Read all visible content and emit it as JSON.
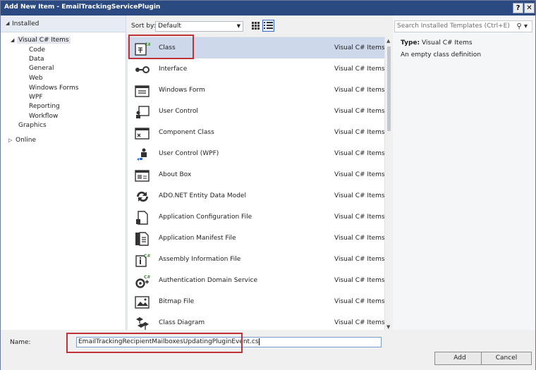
{
  "window": {
    "title": "Add New Item - EmailTrackingServicePlugin",
    "help_label": "?",
    "close_label": "✕"
  },
  "left": {
    "installed_label": "Installed",
    "root_label": "Visual C# Items",
    "children": [
      "Code",
      "Data",
      "General",
      "Web",
      "Windows Forms",
      "WPF",
      "Reporting",
      "Workflow"
    ],
    "graphics_label": "Graphics",
    "online_label": "Online"
  },
  "toolbar": {
    "sort_label": "Sort by:",
    "sort_value": "Default"
  },
  "search": {
    "placeholder": "Search Installed Templates (Ctrl+E)"
  },
  "items": [
    {
      "name": "Class",
      "category": "Visual C# Items",
      "icon": "class-icon"
    },
    {
      "name": "Interface",
      "category": "Visual C# Items",
      "icon": "interface-icon"
    },
    {
      "name": "Windows Form",
      "category": "Visual C# Items",
      "icon": "windows-form-icon"
    },
    {
      "name": "User Control",
      "category": "Visual C# Items",
      "icon": "user-control-icon"
    },
    {
      "name": "Component Class",
      "category": "Visual C# Items",
      "icon": "component-class-icon"
    },
    {
      "name": "User Control (WPF)",
      "category": "Visual C# Items",
      "icon": "wpf-user-control-icon"
    },
    {
      "name": "About Box",
      "category": "Visual C# Items",
      "icon": "about-box-icon"
    },
    {
      "name": "ADO.NET Entity Data Model",
      "category": "Visual C# Items",
      "icon": "entity-model-icon"
    },
    {
      "name": "Application Configuration File",
      "category": "Visual C# Items",
      "icon": "config-file-icon"
    },
    {
      "name": "Application Manifest File",
      "category": "Visual C# Items",
      "icon": "manifest-file-icon"
    },
    {
      "name": "Assembly Information File",
      "category": "Visual C# Items",
      "icon": "assembly-info-icon"
    },
    {
      "name": "Authentication Domain Service",
      "category": "Visual C# Items",
      "icon": "domain-service-icon"
    },
    {
      "name": "Bitmap File",
      "category": "Visual C# Items",
      "icon": "bitmap-icon"
    },
    {
      "name": "Class Diagram",
      "category": "Visual C# Items",
      "icon": "class-diagram-icon"
    }
  ],
  "details": {
    "type_label": "Type:",
    "type_value": "Visual C# Items",
    "description": "An empty class definition"
  },
  "bottom": {
    "name_label": "Name:",
    "name_value": "EmailTrackingRecipientMailboxesUpdatingPluginEvent.cs",
    "add_label": "Add",
    "cancel_label": "Cancel"
  }
}
